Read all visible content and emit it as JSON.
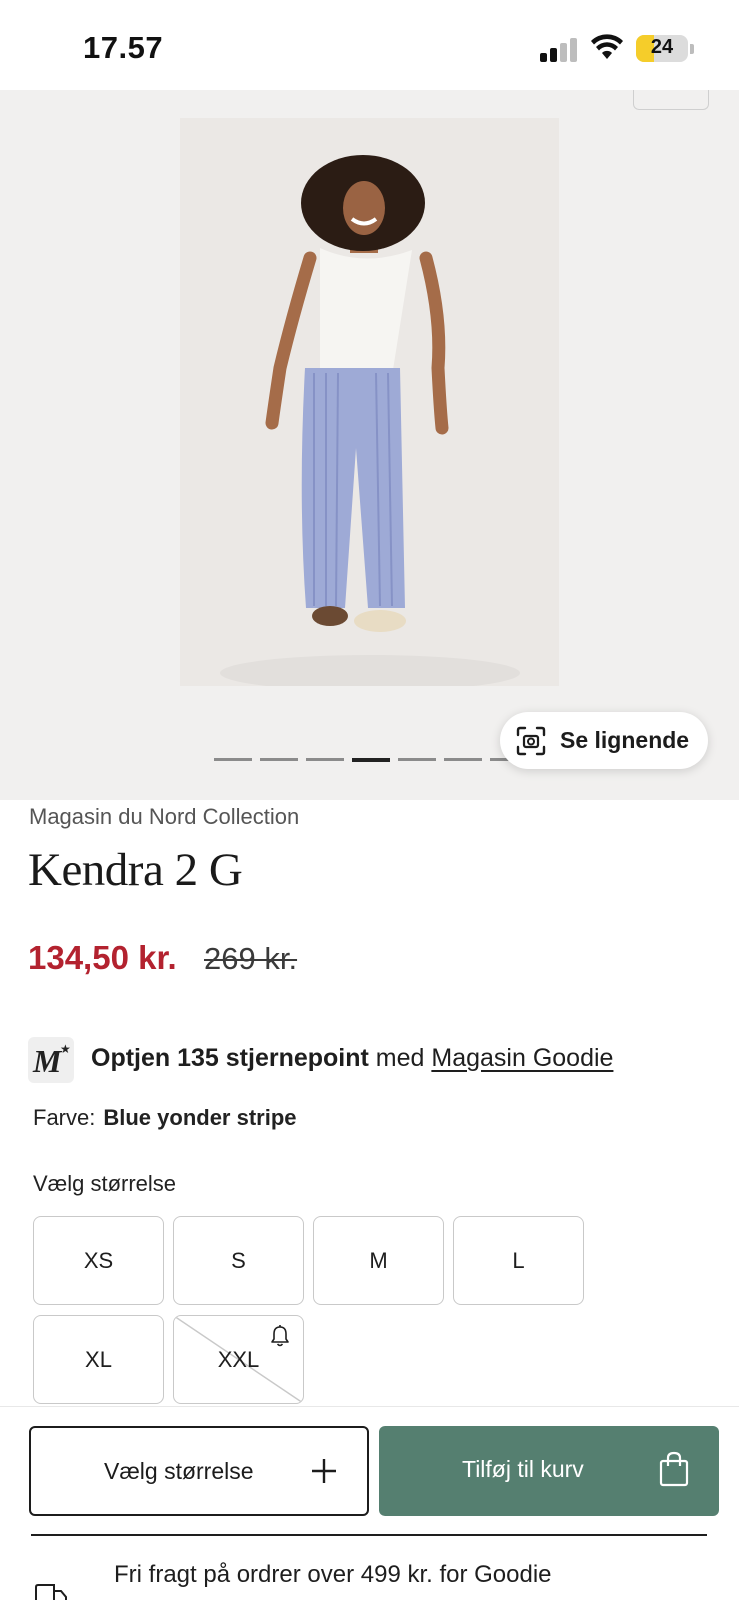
{
  "status_bar": {
    "time": "17.57",
    "battery": "24"
  },
  "gallery": {
    "slide_count": 7,
    "active_slide": 4,
    "similar_label": "Se lignende"
  },
  "product": {
    "brand": "Magasin du Nord Collection",
    "title": "Kendra 2 G",
    "price_sale": "134,50 kr.",
    "price_original": "269 kr."
  },
  "goodie": {
    "bold_text": "Optjen 135 stjernepoint",
    "mid_text": " med ",
    "link_text": "Magasin Goodie"
  },
  "color": {
    "label": "Farve:",
    "value": "Blue yonder stripe"
  },
  "sizes": {
    "heading": "Vælg størrelse",
    "options": [
      {
        "label": "XS",
        "available": true
      },
      {
        "label": "S",
        "available": true
      },
      {
        "label": "M",
        "available": true
      },
      {
        "label": "L",
        "available": true
      },
      {
        "label": "XL",
        "available": true
      },
      {
        "label": "XXL",
        "available": false
      }
    ]
  },
  "actions": {
    "choose_size": "Vælg størrelse",
    "add_to_cart": "Tilføj til kurv"
  },
  "shipping": {
    "text": "Fri fragt på ordrer over 499 kr. for Goodie"
  },
  "colors": {
    "sale": "#b3222f",
    "cart_button": "#557f70"
  }
}
